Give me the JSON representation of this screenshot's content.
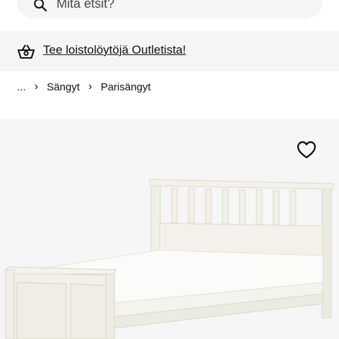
{
  "search": {
    "placeholder": "Mitä etsit?",
    "icon": "search-icon"
  },
  "promo": {
    "icon": "basket-icon",
    "link_text": "Tee loistolöytöjä Outletista!"
  },
  "breadcrumb": {
    "ellipsis": "...",
    "items": [
      "Sängyt",
      "Parisängyt"
    ]
  },
  "product": {
    "favourite_icon": "heart-icon",
    "image": "white wooden double bed with mattress"
  },
  "colors": {
    "promo_background": "#f5f5f5",
    "search_background": "#f5f5f5",
    "image_background": "#f6f6f6",
    "text": "#111111"
  }
}
